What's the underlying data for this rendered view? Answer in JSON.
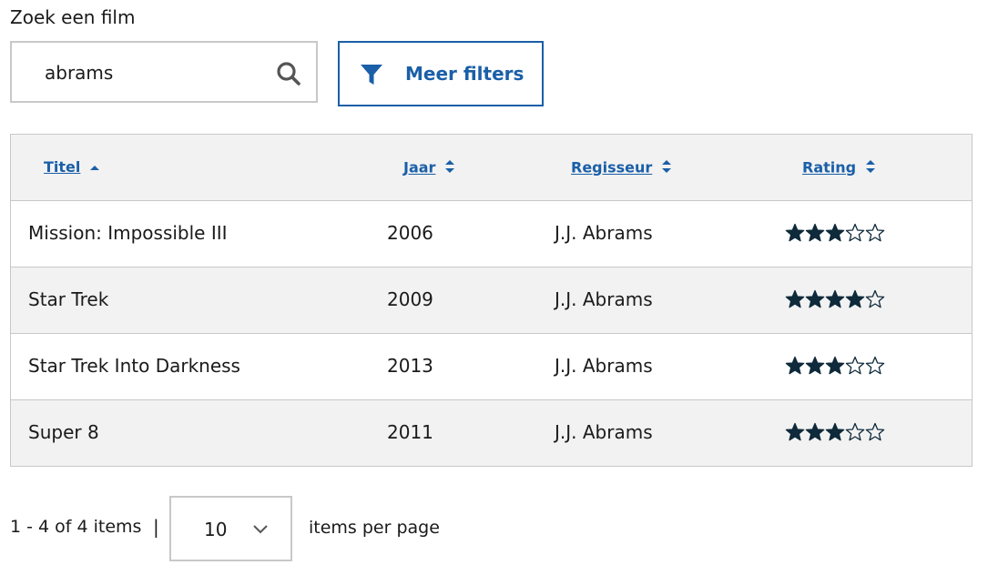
{
  "search": {
    "label": "Zoek een film",
    "value": "abrams",
    "icon": "search-icon"
  },
  "filters": {
    "label": "Meer filters",
    "icon": "filter-icon"
  },
  "table": {
    "columns": [
      {
        "label": "Titel",
        "sort": "ascending"
      },
      {
        "label": "Jaar",
        "sort": "none"
      },
      {
        "label": "Regisseur",
        "sort": "none"
      },
      {
        "label": "Rating",
        "sort": "none"
      }
    ],
    "rows": [
      {
        "title": "Mission: Impossible III",
        "year": "2006",
        "director": "J.J. Abrams",
        "rating": 3
      },
      {
        "title": "Star Trek",
        "year": "2009",
        "director": "J.J. Abrams",
        "rating": 4
      },
      {
        "title": "Star Trek Into Darkness",
        "year": "2013",
        "director": "J.J. Abrams",
        "rating": 3
      },
      {
        "title": "Super 8",
        "year": "2011",
        "director": "J.J. Abrams",
        "rating": 3
      }
    ],
    "max_rating": 5
  },
  "pagination": {
    "range": "1 - 4 of 4 items",
    "separator": "|",
    "page_size": "10",
    "per_page_label": "items per page"
  },
  "colors": {
    "accent": "#1a5fa8",
    "star": "#0f2a3a",
    "row_alt": "#f2f2f2",
    "border": "#c8c8c8"
  }
}
